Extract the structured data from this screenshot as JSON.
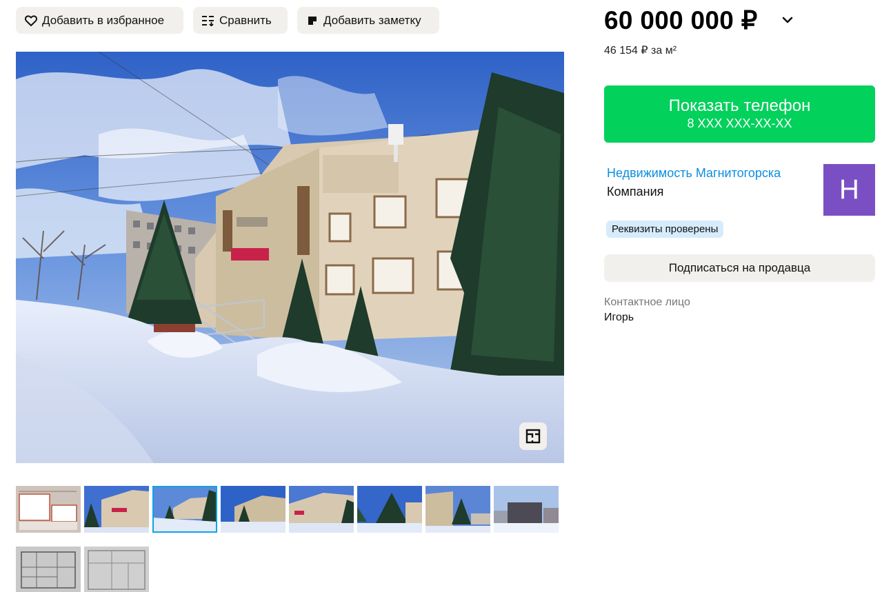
{
  "actions": {
    "favorite_label": "Добавить в избранное",
    "compare_label": "Сравнить",
    "note_label": "Добавить заметку"
  },
  "gallery": {
    "thumbnail_count": 10,
    "active_index": 2,
    "main_photo_icon": "floor-plan-icon"
  },
  "offer": {
    "price": "60 000 000 ₽",
    "price_per_sqm": "46 154 ₽ за м²"
  },
  "contact": {
    "show_phone_label": "Показать телефон",
    "phone_masked": "8 XXX XXX-XX-XX",
    "seller_name": "Недвижимость Магнитогорска",
    "seller_type": "Компания",
    "avatar_letter": "Н",
    "verified_badge": "Реквизиты проверены",
    "subscribe_label": "Подписаться на продавца",
    "contact_person_label": "Контактное лицо",
    "contact_person_name": "Игорь"
  },
  "colors": {
    "accent_green": "#02d15c",
    "link_blue": "#0b8ee0",
    "avatar_purple": "#7b4fc4",
    "badge_blue": "#d6ecfd",
    "button_gray": "#f2f0ec"
  }
}
